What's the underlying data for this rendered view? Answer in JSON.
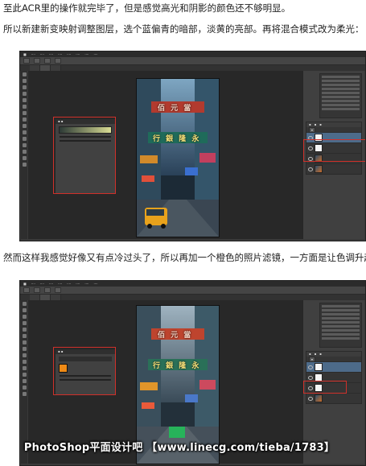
{
  "paragraphs": [
    "至此ACR里的操作就完毕了，但是感觉高光和阴影的颜色还不够明显。",
    "所以新建新变映射调整图层，选个蓝偏青的暗部，淡黄的亮部。再将混合模式改为柔光：",
    "然而这样我感觉好像又有点冷过头了，所以再加一个橙色的照片滤镜，一方面是让色调升起来一点，另外一方面给图片多一点橙色元素："
  ],
  "photo_signs": {
    "sign_top": "佰 元 當",
    "sign_mid": "行 銀 隆 永"
  },
  "watermark": "PhotoShop平面设计吧 【www.linecg.com/tieba/1783】",
  "colors": {
    "accent_red": "#d0302a",
    "gradient_dark": "#2d3a36",
    "gradient_light": "#d9dd94",
    "filter_orange": "#ef8a16"
  }
}
